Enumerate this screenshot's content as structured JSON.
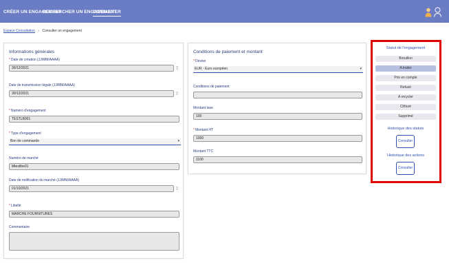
{
  "nav": {
    "create": "CRÉER UN ENGAGEMENT",
    "search": "RECHERCHER UN ENGAGEMENT",
    "consult": "CONSULTER"
  },
  "breadcrumb": {
    "link": "Espace Consultation",
    "separator": "›",
    "current": "Consulter un engagement"
  },
  "general": {
    "title": "Informations générales",
    "creation_date_label": "Date de création (JJ/MM/AAAA)",
    "creation_date": "30/12/2021",
    "transmission_date_label": "Date de transmission légale (JJ/MM/AAAA)",
    "transmission_date": "30/12/2021",
    "engagement_number_label": "Numéro d'engagement",
    "engagement_number": "TESTLB001",
    "engagement_type_label": "Type d'engagement",
    "engagement_type": "Bon de commande",
    "market_number_label": "Numéro de marché",
    "market_number": "Mtestlbe01",
    "notification_date_label": "Date de notification du marché (JJ/MM/AAAA)",
    "notification_date": "01/10/2021",
    "label_label": "Libellé",
    "label": "MARCHE FOURNITURES",
    "comment_label": "Commentaire"
  },
  "payment": {
    "title": "Conditions de paiement et montant",
    "currency_label": "Devise",
    "currency": "EUR - Euro européen",
    "conditions_label": "Conditions de paiement",
    "tax_rate_label": "Montant taxe",
    "tax_rate": "100",
    "amount_ht_label": "Montant HT",
    "amount_ht": "1000",
    "amount_ttc_label": "Montant TTC",
    "amount_ttc": "1100"
  },
  "status": {
    "title": "Statut de l'engagement",
    "items": [
      "Brouillon",
      "A traiter",
      "Pris en compte",
      "Refusé",
      "A recycler",
      "Clôturé",
      "Supprimé"
    ],
    "active_index": 1,
    "history_status_title": "Historique des statuts",
    "history_status_button": "Consulter",
    "history_actions_title": "Historique des actions",
    "history_actions_button": "Consulter"
  },
  "icons": {
    "select_caret": "▾",
    "calendar": "calendar-icon"
  },
  "colors": {
    "topbar": "#6a7cc4",
    "accent": "#3050b0",
    "highlight_box": "#e00000",
    "active_status": "#b7bfe0"
  }
}
